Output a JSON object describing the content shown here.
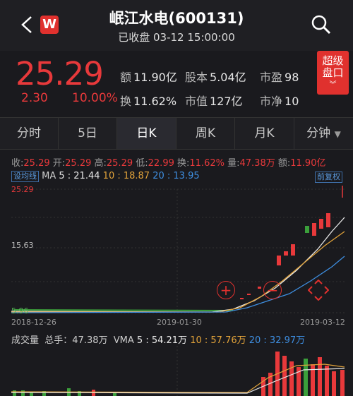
{
  "header": {
    "back_icon": "chevron-left-icon",
    "logo_letter": "W",
    "title": "岷江水电(600131)",
    "subtitle": "已收盘 03-12 15:00:00",
    "search_icon": "search-icon"
  },
  "quote": {
    "price": "25.29",
    "change": "2.30",
    "change_pct": "10.00%",
    "stats": [
      {
        "label": "额",
        "value": "11.90亿"
      },
      {
        "label": "股本",
        "value": "5.04亿"
      },
      {
        "label": "市盈",
        "value": "98"
      },
      {
        "label": "换",
        "value": "11.62%"
      },
      {
        "label": "市值",
        "value": "127亿"
      },
      {
        "label": "市净",
        "value": "10"
      }
    ],
    "super_line1": "超级",
    "super_line2": "盘口",
    "up_color": "#e8393b"
  },
  "tabs": [
    "分时",
    "5日",
    "日K",
    "周K",
    "月K",
    "分钟"
  ],
  "active_tab": "日K",
  "ohlc": {
    "open_label": "收:",
    "close": "25.29",
    "o_label": "开:",
    "open": "25.29",
    "h_label": "高:",
    "high": "25.29",
    "l_label": "低:",
    "low": "22.99",
    "t_label": "换:",
    "turnover": "11.62%",
    "v_label": "量:",
    "volume": "47.38万",
    "a_label": "额:",
    "amount": "11.90亿"
  },
  "ma": {
    "toggle": "设均线",
    "label": "MA",
    "ma5": "5 : 21.44",
    "ma10": "10 : 18.87",
    "ma20": "20 : 13.95",
    "adjust": "前复权"
  },
  "price_axis": [
    "25.29",
    "15.63",
    "5.96"
  ],
  "date_axis": [
    "2018-12-26",
    "2019-01-30",
    "2019-03-12"
  ],
  "volume": {
    "label": "成交量",
    "total": "总手：47.38万",
    "vma": "VMA",
    "v5": "5 : 54.21万",
    "v10": "10 : 57.76万",
    "v20": "20 : 32.97万"
  },
  "zoom": {
    "in_icon": "zoom-in-icon",
    "out_icon": "zoom-out-icon",
    "move_icon": "move-icon"
  }
}
